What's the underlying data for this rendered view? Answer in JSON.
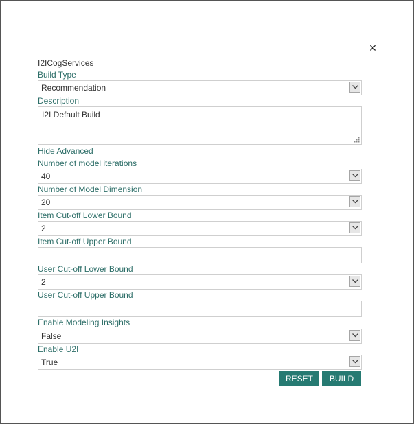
{
  "dialog": {
    "title": "I2ICogServices",
    "close_icon": "×"
  },
  "fields": {
    "build_type": {
      "label": "Build Type",
      "value": "Recommendation"
    },
    "description": {
      "label": "Description",
      "value": "I2I Default Build"
    },
    "hide_advanced": "Hide Advanced",
    "model_iterations": {
      "label": "Number of model iterations",
      "value": "40"
    },
    "model_dimension": {
      "label": "Number of Model Dimension",
      "value": "20"
    },
    "item_cutoff_lower": {
      "label": "Item Cut-off Lower Bound",
      "value": "2"
    },
    "item_cutoff_upper": {
      "label": "Item Cut-off Upper Bound",
      "value": ""
    },
    "user_cutoff_lower": {
      "label": "User Cut-off Lower Bound",
      "value": "2"
    },
    "user_cutoff_upper": {
      "label": "User Cut-off Upper Bound",
      "value": ""
    },
    "modeling_insights": {
      "label": "Enable Modeling Insights",
      "value": "False"
    },
    "enable_u2i": {
      "label": "Enable U2I",
      "value": "True"
    }
  },
  "buttons": {
    "reset": "RESET",
    "build": "BUILD"
  },
  "colors": {
    "accent": "#267a72",
    "label": "#2d6e68"
  }
}
